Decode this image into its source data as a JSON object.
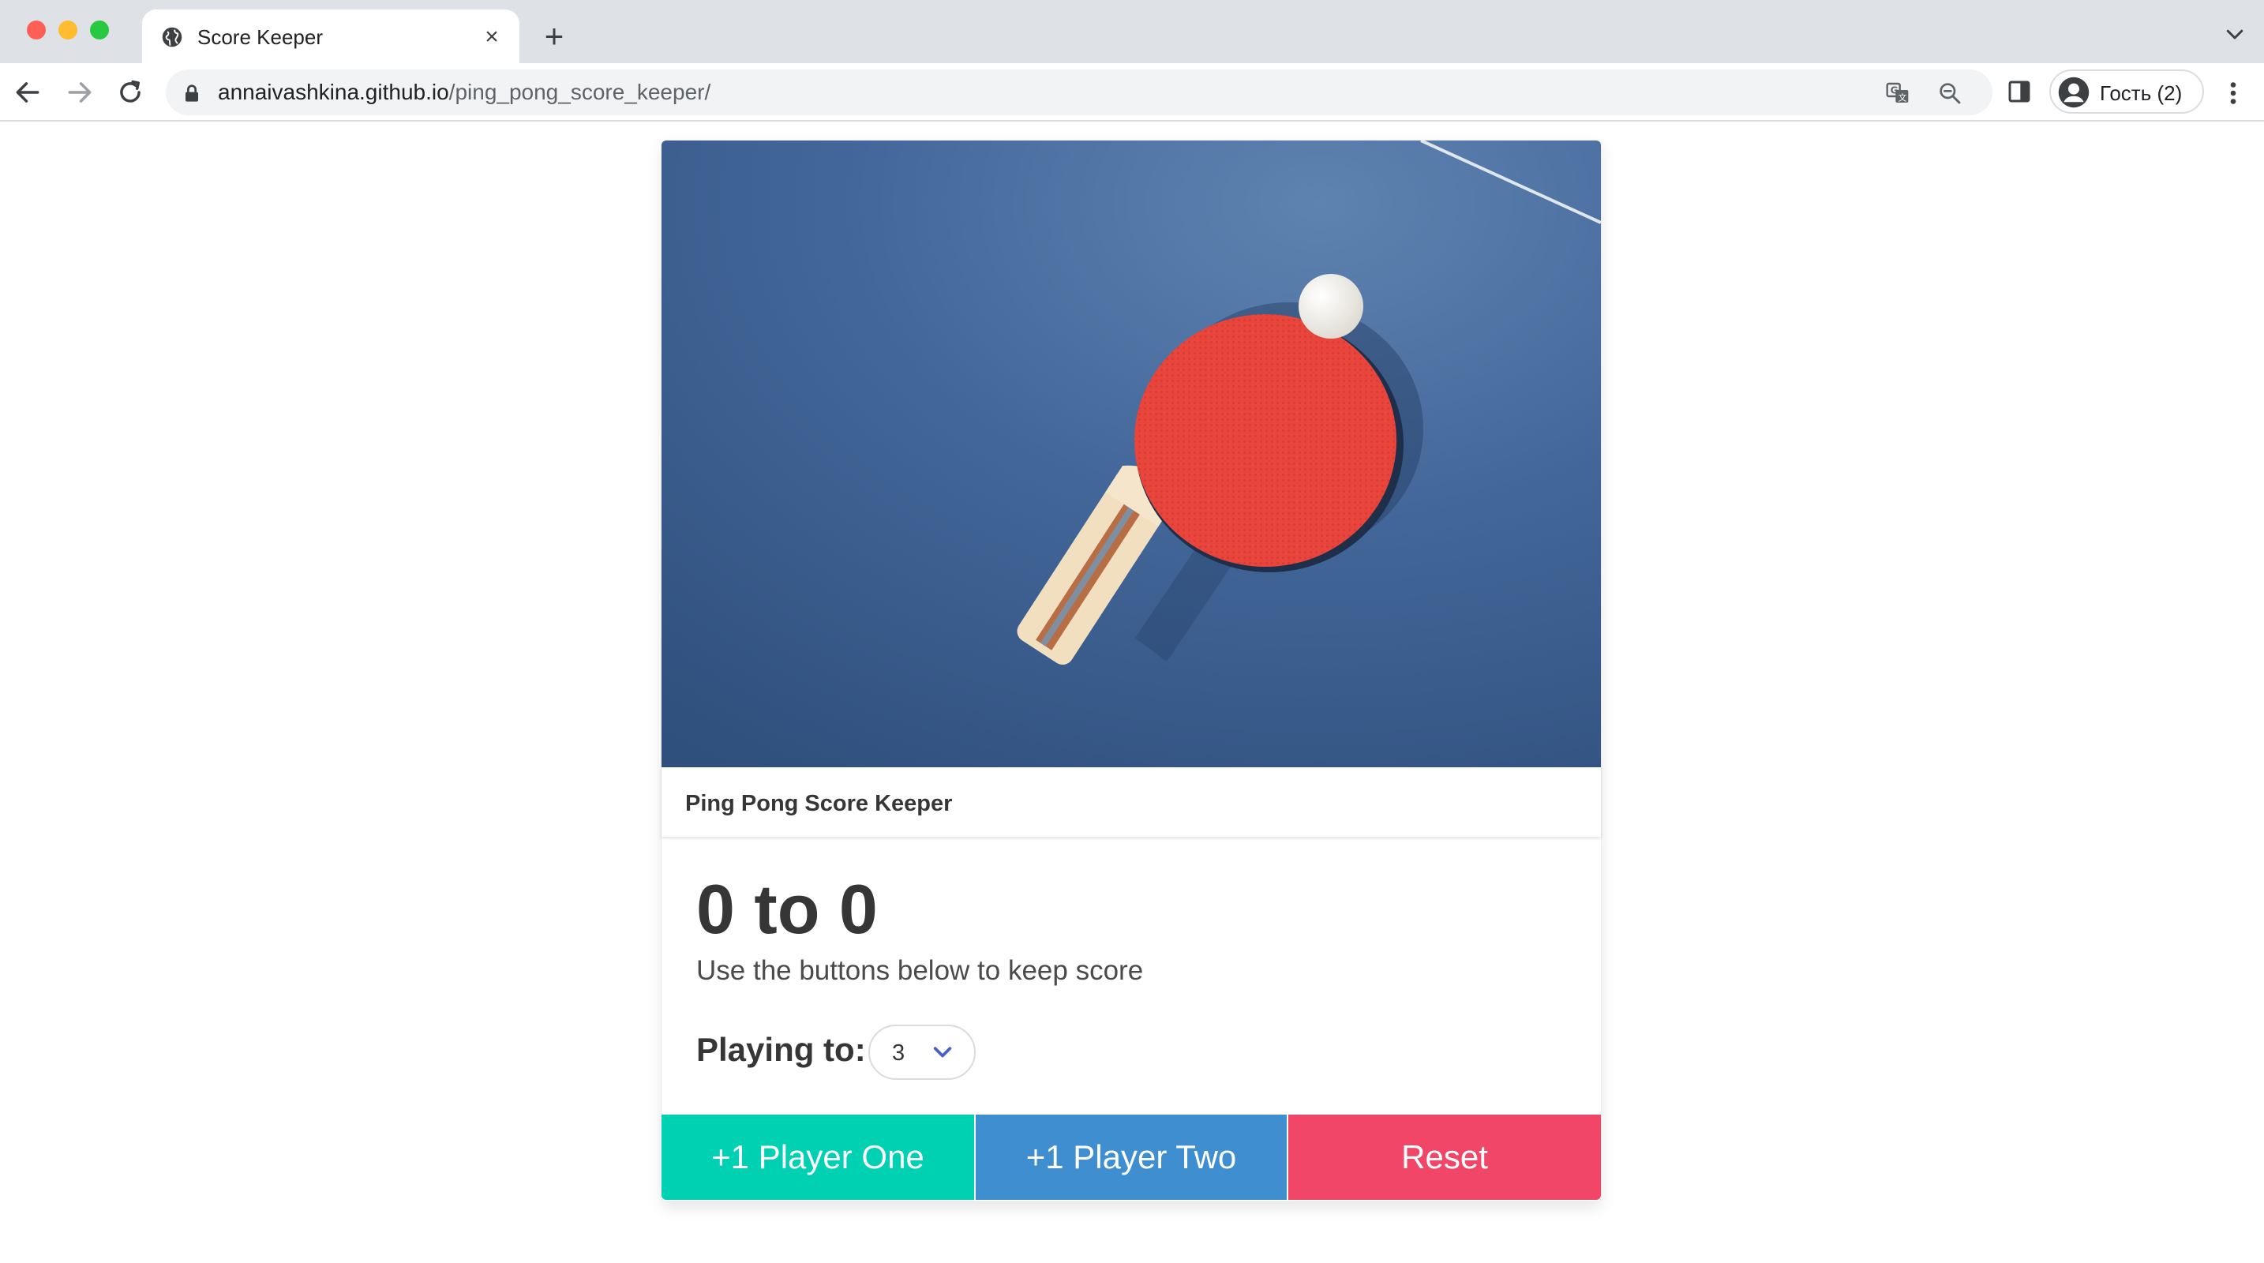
{
  "browser": {
    "tab_title": "Score Keeper",
    "tab_close": "×",
    "new_tab": "+",
    "url_host": "annaivashkina.github.io",
    "url_path": "/ping_pong_score_keeper/",
    "profile_label": "Гость (2)"
  },
  "icons": {
    "tab_favicon": "globe-icon",
    "back": "arrow-left-icon",
    "forward": "arrow-right-icon",
    "reload": "reload-icon",
    "lock": "lock-icon",
    "translate": "translate-icon",
    "zoom": "zoom-out-icon",
    "side_panel": "side-panel-icon",
    "profile": "person-icon",
    "menu": "kebab-menu-icon"
  },
  "page": {
    "card_title": "Ping Pong Score Keeper",
    "score_display": "0 to 0",
    "instructions": "Use the buttons below to keep score",
    "playing_to_label": "Playing to:",
    "playing_to_value": "3",
    "buttons": {
      "player_one": "+1 Player One",
      "player_two": "+1 Player Two",
      "reset": "Reset"
    }
  },
  "colors": {
    "player_one": "#00d1b2",
    "player_two": "#3e8ed0",
    "reset": "#f14668",
    "table_blue": "#3a5f8c",
    "paddle_red": "#e8453c"
  }
}
